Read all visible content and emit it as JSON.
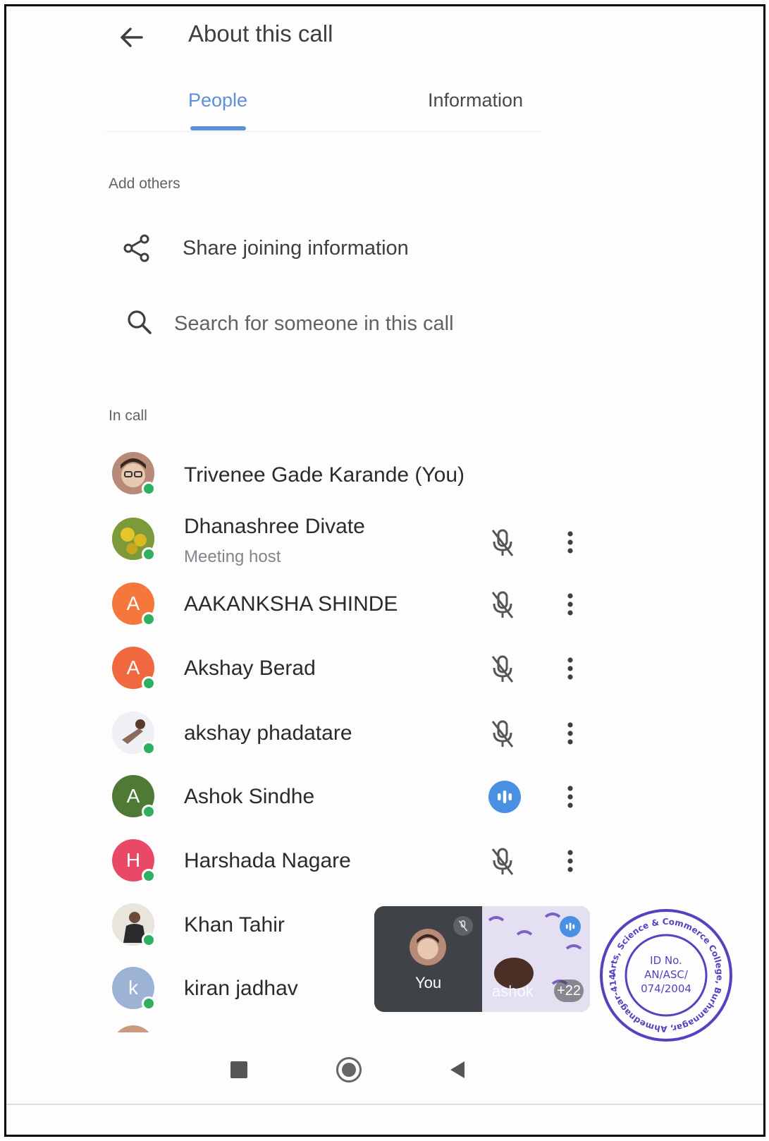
{
  "header": {
    "title": "About this call"
  },
  "tabs": [
    {
      "label": "People",
      "active": true
    },
    {
      "label": "Information",
      "active": false
    }
  ],
  "add_others": {
    "label": "Add others",
    "share_label": "Share joining information",
    "search_placeholder": "Search for someone in this call"
  },
  "in_call": {
    "label": "In call",
    "participants": [
      {
        "name": "Trivenee Gade Karande (You)",
        "subtitle": "",
        "avatar": "photo",
        "status": "none"
      },
      {
        "name": "Dhanashree Divate",
        "subtitle": "Meeting host",
        "avatar": "photo",
        "status": "muted"
      },
      {
        "name": "AAKANKSHA SHINDE",
        "initial": "A",
        "avatar_color": "#f4773b",
        "status": "muted"
      },
      {
        "name": "Akshay Berad",
        "initial": "A",
        "avatar_color": "#f1683f",
        "status": "muted"
      },
      {
        "name": "akshay phadatare",
        "avatar": "photo",
        "status": "muted"
      },
      {
        "name": "Ashok Sindhe",
        "initial": "A",
        "avatar_color": "#4e7a35",
        "status": "speaking"
      },
      {
        "name": "Harshada Nagare",
        "initial": "H",
        "avatar_color": "#e94867",
        "status": "muted"
      },
      {
        "name": "Khan Tahir",
        "avatar": "photo",
        "status": "none"
      },
      {
        "name": "kiran jadhav",
        "initial": "k",
        "avatar_color": "#9db3d6",
        "status": "none"
      }
    ]
  },
  "pip": {
    "self_label": "You",
    "other_label": "ashok",
    "more_count": "+22"
  },
  "stamp": {
    "ring_text": "Arts, Science & Commerce College, Burhannagar, Ahmednagar-414002",
    "id_line1": "ID No.",
    "id_line2": "AN/ASC/",
    "id_line3": "074/2004"
  },
  "colors": {
    "accent": "#5b8fd8",
    "online": "#2eb060",
    "stamp": "#5a3fc0"
  }
}
